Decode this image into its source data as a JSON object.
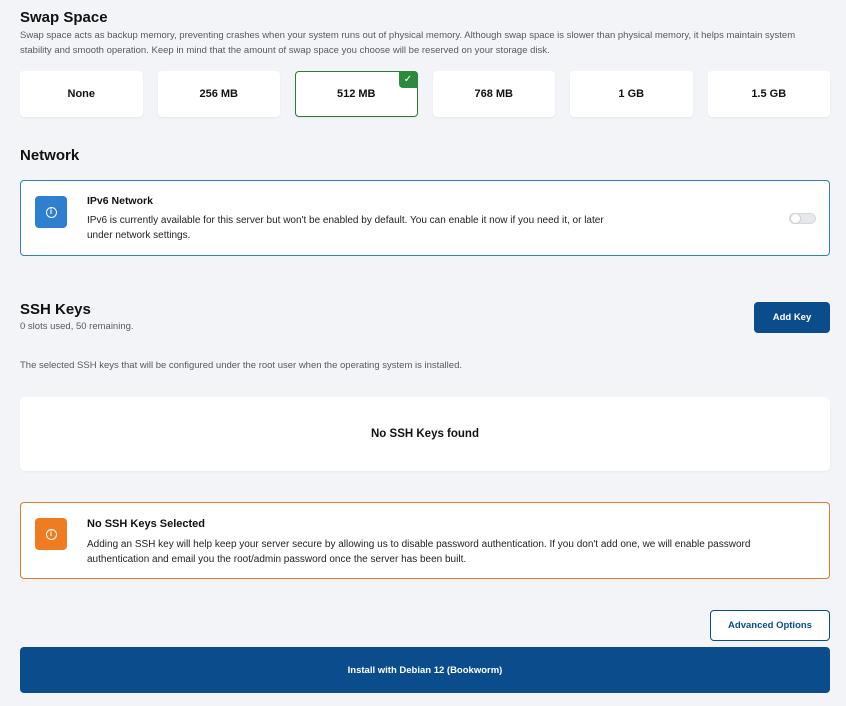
{
  "swap": {
    "title": "Swap Space",
    "description": "Swap space acts as backup memory, preventing crashes when your system runs out of physical memory. Although swap space is slower than physical memory, it helps maintain system stability and smooth operation. Keep in mind that the amount of swap space you choose will be reserved on your storage disk.",
    "options": [
      "None",
      "256 MB",
      "512 MB",
      "768 MB",
      "1 GB",
      "1.5 GB"
    ],
    "selected": "512 MB",
    "check_glyph": "✓"
  },
  "network": {
    "title": "Network",
    "card_title": "IPv6 Network",
    "card_text_line1": "IPv6 is currently available for this server but won't be enabled by default. You can enable it now if you need it, or later",
    "card_text_line2": "under network settings.",
    "icon_glyph": "i",
    "accent": "#2f7fd0",
    "enabled": false
  },
  "ssh": {
    "title": "SSH Keys",
    "slots_text": "0 slots used, 50 remaining.",
    "add_button": "Add Key",
    "help_text": "The selected SSH keys that will be configured under the root user when the operating system is installed.",
    "empty_text": "No SSH Keys found",
    "warn_title": "No SSH Keys Selected",
    "warn_line1": "Adding an SSH key will help keep your server secure by allowing us to disable password authentication. If you don't add one, we will enable password",
    "warn_line2": "authentication and email you the root/admin password once the server has been built.",
    "warn_icon_glyph": "i",
    "warn_accent": "#f07c22"
  },
  "footer": {
    "advanced_button": "Advanced Options",
    "install_button": "Install with Debian 12 (Bookworm)"
  },
  "colors": {
    "primary": "#0b4d8c",
    "success": "#2b8a3e",
    "background": "#f3f4f8"
  }
}
